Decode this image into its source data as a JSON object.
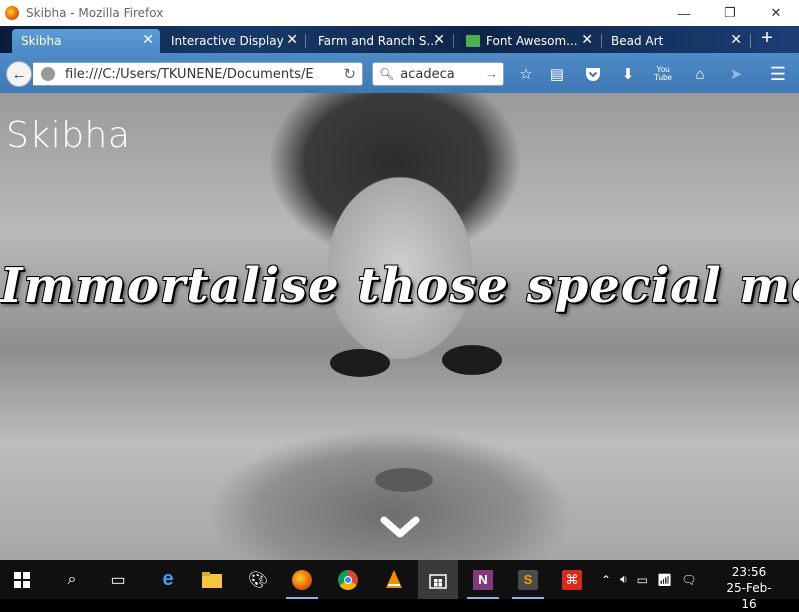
{
  "window": {
    "title": "Skibha - Mozilla Firefox",
    "controls": {
      "minimize": "—",
      "restore": "❐",
      "close": "✕"
    }
  },
  "tabs": [
    {
      "label": "Skibha",
      "active": true
    },
    {
      "label": "Interactive Display",
      "active": false
    },
    {
      "label": "Farm and Ranch S...",
      "active": false
    },
    {
      "label": "Font Awesom...",
      "active": false
    },
    {
      "label": "Bead Art",
      "active": false
    }
  ],
  "toolbar": {
    "url": "file:///C:/Users/TKUNENE/Documents/E",
    "search_value": "acadeca",
    "new_tab": "+",
    "youtube_label": "You Tube"
  },
  "page": {
    "brand": "Skibha",
    "tagline": "Immortalise those special moments"
  },
  "taskbar": {
    "time": "23:56",
    "date": "25-Feb-16",
    "onenote_label": "N",
    "sublime_label": "S"
  }
}
